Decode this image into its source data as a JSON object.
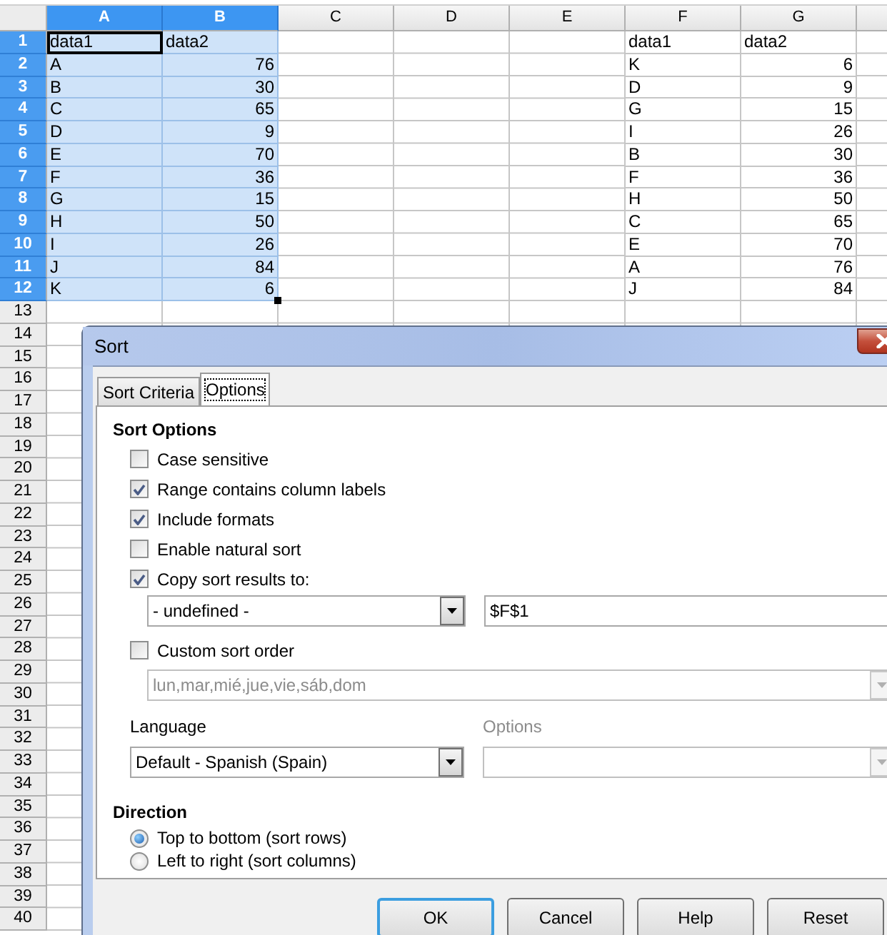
{
  "sheet": {
    "columns": [
      {
        "label": "A",
        "selected": true
      },
      {
        "label": "B",
        "selected": true
      },
      {
        "label": "C",
        "selected": false
      },
      {
        "label": "D",
        "selected": false
      },
      {
        "label": "E",
        "selected": false
      },
      {
        "label": "F",
        "selected": false
      },
      {
        "label": "G",
        "selected": false
      }
    ],
    "rows": [
      {
        "label": "1",
        "selected": true,
        "source": [
          {
            "text": "data1",
            "kind": "text",
            "active": true
          },
          {
            "text": "data2",
            "kind": "text",
            "active": false
          }
        ],
        "result": [
          {
            "text": "data1",
            "kind": "text"
          },
          {
            "text": "data2",
            "kind": "text"
          }
        ]
      },
      {
        "label": "2",
        "selected": true,
        "source": [
          {
            "text": "A",
            "kind": "text",
            "active": false
          },
          {
            "text": "76",
            "kind": "number",
            "active": false
          }
        ],
        "result": [
          {
            "text": "K",
            "kind": "text"
          },
          {
            "text": "6",
            "kind": "number"
          }
        ]
      },
      {
        "label": "3",
        "selected": true,
        "source": [
          {
            "text": "B",
            "kind": "text",
            "active": false
          },
          {
            "text": "30",
            "kind": "number",
            "active": false
          }
        ],
        "result": [
          {
            "text": "D",
            "kind": "text"
          },
          {
            "text": "9",
            "kind": "number"
          }
        ]
      },
      {
        "label": "4",
        "selected": true,
        "source": [
          {
            "text": "C",
            "kind": "text",
            "active": false
          },
          {
            "text": "65",
            "kind": "number",
            "active": false
          }
        ],
        "result": [
          {
            "text": "G",
            "kind": "text"
          },
          {
            "text": "15",
            "kind": "number"
          }
        ]
      },
      {
        "label": "5",
        "selected": true,
        "source": [
          {
            "text": "D",
            "kind": "text",
            "active": false
          },
          {
            "text": "9",
            "kind": "number",
            "active": false
          }
        ],
        "result": [
          {
            "text": "I",
            "kind": "text"
          },
          {
            "text": "26",
            "kind": "number"
          }
        ]
      },
      {
        "label": "6",
        "selected": true,
        "source": [
          {
            "text": "E",
            "kind": "text",
            "active": false
          },
          {
            "text": "70",
            "kind": "number",
            "active": false
          }
        ],
        "result": [
          {
            "text": "B",
            "kind": "text"
          },
          {
            "text": "30",
            "kind": "number"
          }
        ]
      },
      {
        "label": "7",
        "selected": true,
        "source": [
          {
            "text": "F",
            "kind": "text",
            "active": false
          },
          {
            "text": "36",
            "kind": "number",
            "active": false
          }
        ],
        "result": [
          {
            "text": "F",
            "kind": "text"
          },
          {
            "text": "36",
            "kind": "number"
          }
        ]
      },
      {
        "label": "8",
        "selected": true,
        "source": [
          {
            "text": "G",
            "kind": "text",
            "active": false
          },
          {
            "text": "15",
            "kind": "number",
            "active": false
          }
        ],
        "result": [
          {
            "text": "H",
            "kind": "text"
          },
          {
            "text": "50",
            "kind": "number"
          }
        ]
      },
      {
        "label": "9",
        "selected": true,
        "source": [
          {
            "text": "H",
            "kind": "text",
            "active": false
          },
          {
            "text": "50",
            "kind": "number",
            "active": false
          }
        ],
        "result": [
          {
            "text": "C",
            "kind": "text"
          },
          {
            "text": "65",
            "kind": "number"
          }
        ]
      },
      {
        "label": "10",
        "selected": true,
        "source": [
          {
            "text": "I",
            "kind": "text",
            "active": false
          },
          {
            "text": "26",
            "kind": "number",
            "active": false
          }
        ],
        "result": [
          {
            "text": "E",
            "kind": "text"
          },
          {
            "text": "70",
            "kind": "number"
          }
        ]
      },
      {
        "label": "11",
        "selected": true,
        "source": [
          {
            "text": "J",
            "kind": "text",
            "active": false
          },
          {
            "text": "84",
            "kind": "number",
            "active": false
          }
        ],
        "result": [
          {
            "text": "A",
            "kind": "text"
          },
          {
            "text": "76",
            "kind": "number"
          }
        ]
      },
      {
        "label": "12",
        "selected": true,
        "source": [
          {
            "text": "K",
            "kind": "text",
            "active": false
          },
          {
            "text": "6",
            "kind": "number",
            "active": false
          }
        ],
        "result": [
          {
            "text": "J",
            "kind": "text"
          },
          {
            "text": "84",
            "kind": "number"
          }
        ]
      },
      {
        "label": "13",
        "selected": false
      },
      {
        "label": "14",
        "selected": false
      },
      {
        "label": "15",
        "selected": false
      },
      {
        "label": "16",
        "selected": false
      },
      {
        "label": "17",
        "selected": false
      },
      {
        "label": "18",
        "selected": false
      },
      {
        "label": "19",
        "selected": false
      },
      {
        "label": "20",
        "selected": false
      },
      {
        "label": "21",
        "selected": false
      },
      {
        "label": "22",
        "selected": false
      },
      {
        "label": "23",
        "selected": false
      },
      {
        "label": "24",
        "selected": false
      },
      {
        "label": "25",
        "selected": false
      },
      {
        "label": "26",
        "selected": false
      },
      {
        "label": "27",
        "selected": false
      },
      {
        "label": "28",
        "selected": false
      },
      {
        "label": "29",
        "selected": false
      },
      {
        "label": "30",
        "selected": false
      },
      {
        "label": "31",
        "selected": false
      },
      {
        "label": "32",
        "selected": false
      },
      {
        "label": "33",
        "selected": false
      },
      {
        "label": "34",
        "selected": false
      },
      {
        "label": "35",
        "selected": false
      },
      {
        "label": "36",
        "selected": false
      },
      {
        "label": "37",
        "selected": false
      },
      {
        "label": "38",
        "selected": false
      },
      {
        "label": "39",
        "selected": false
      },
      {
        "label": "40",
        "selected": false
      }
    ]
  },
  "dialog": {
    "title": "Sort",
    "tabs": [
      {
        "label": "Sort Criteria",
        "selected": false
      },
      {
        "label": "Options",
        "selected": true
      }
    ],
    "sort_options": {
      "heading": "Sort Options",
      "checkboxes": [
        {
          "label": "Case sensitive",
          "checked": false
        },
        {
          "label": "Range contains column labels",
          "checked": true
        },
        {
          "label": "Include formats",
          "checked": true
        },
        {
          "label": "Enable natural sort",
          "checked": false
        },
        {
          "label": "Copy sort results to:",
          "checked": true
        }
      ],
      "copy_range_dropdown": {
        "value": "- undefined -"
      },
      "copy_target_field": {
        "value": "$F$1"
      },
      "custom_order": {
        "label": "Custom sort order",
        "checked": false
      },
      "custom_order_dropdown": {
        "value": "lun,mar,mié,jue,vie,sáb,dom",
        "disabled": true
      },
      "language": {
        "label": "Language",
        "value": "Default - Spanish (Spain)"
      },
      "language_options": {
        "label": "Options",
        "disabled": true
      }
    },
    "direction": {
      "heading": "Direction",
      "radios": [
        {
          "label": "Top to bottom (sort rows)",
          "selected": true
        },
        {
          "label": "Left to right (sort columns)",
          "selected": false
        }
      ]
    },
    "buttons": [
      {
        "label": "OK",
        "default": true
      },
      {
        "label": "Cancel",
        "default": false
      },
      {
        "label": "Help",
        "default": false
      },
      {
        "label": "Reset",
        "default": false
      }
    ]
  }
}
